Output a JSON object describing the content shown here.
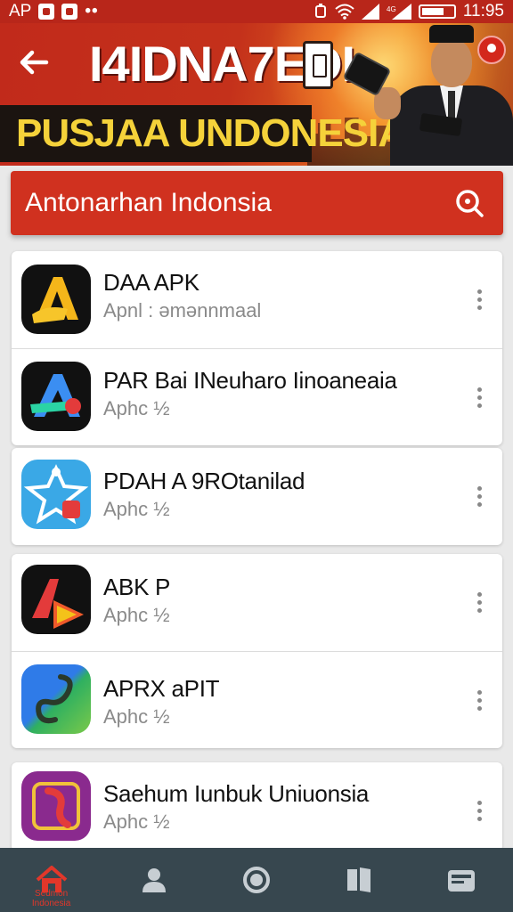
{
  "status_bar": {
    "left_text": "AP",
    "dots": "••",
    "time": "11:95"
  },
  "banner": {
    "title": "I4IDNA7EDI",
    "subtitle": "PUSJAA UNDONESIA"
  },
  "search": {
    "text": "Antonarhan Indonsia"
  },
  "apps": [
    {
      "title": "DAA APK",
      "subtitle": "Apnl : əmənnmaal",
      "icon": "yellow-a-icon"
    },
    {
      "title": "PAR Bai INeuharo Iinoaneaia",
      "subtitle": "Aphc ½",
      "icon": "gradient-a-icon"
    },
    {
      "title": "PDAH A 9ROtanilad",
      "subtitle": "Aphc ½",
      "icon": "blue-star-icon"
    },
    {
      "title": "ABK P",
      "subtitle": "Aphc ½",
      "icon": "red-play-icon"
    },
    {
      "title": "APRX aPIT",
      "subtitle": "Aphc ½",
      "icon": "green-s-icon"
    },
    {
      "title": "Saehum Iunbuk Uniuonsia",
      "subtitle": "Aphc ½",
      "icon": "purple-flag-icon"
    }
  ],
  "bottom_nav": {
    "home_label": "Sedmon Indonesia",
    "items": [
      "home-icon",
      "profile-icon",
      "circle-icon",
      "book-icon",
      "wallet-icon"
    ]
  },
  "colors": {
    "primary": "#d0311f",
    "status_bar": "#b8261a",
    "nav_bg": "#37474f",
    "accent_yellow": "#f5d23a"
  }
}
